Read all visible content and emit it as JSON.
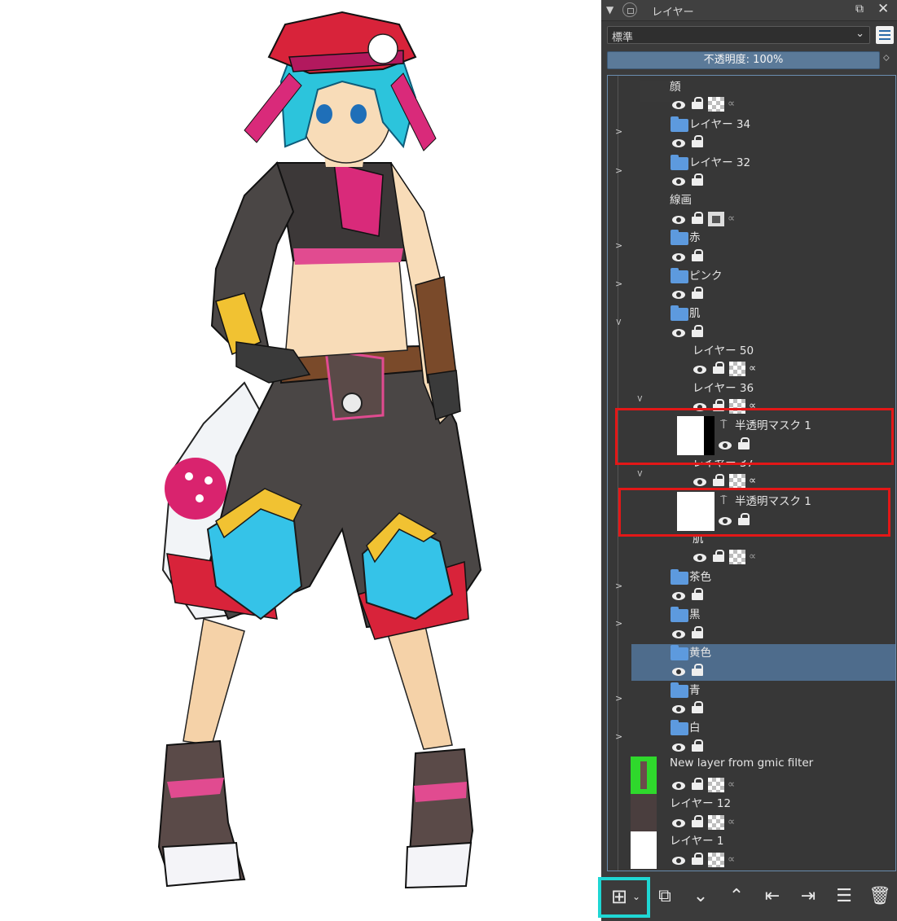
{
  "panel": {
    "title": "レイヤー",
    "blend_mode": "標準",
    "opacity_label": "不透明度:  100%"
  },
  "layers": [
    {
      "name": "顔"
    },
    {
      "name": "レイヤー 34"
    },
    {
      "name": "レイヤー 32"
    },
    {
      "name": "線画"
    },
    {
      "name": "赤"
    },
    {
      "name": "ピンク"
    },
    {
      "name": "肌"
    },
    {
      "name": "レイヤー 50"
    },
    {
      "name": "レイヤー 36"
    },
    {
      "name": "半透明マスク 1"
    },
    {
      "name": "レイヤー 37"
    },
    {
      "name": "半透明マスク 1"
    },
    {
      "name": "肌"
    },
    {
      "name": "茶色"
    },
    {
      "name": "黒"
    },
    {
      "name": "黄色",
      "selected": true
    },
    {
      "name": "青"
    },
    {
      "name": "白"
    },
    {
      "name": "New layer from gmic filter"
    },
    {
      "name": "レイヤー 12"
    },
    {
      "name": "レイヤー 1"
    }
  ],
  "canvas": {
    "image": "anime-girl-character-illustration",
    "hair_color": "#2cc4dc",
    "beret_color": "#d8233a",
    "accent_color": "#d92a7a"
  },
  "toolbar": {
    "icons": [
      "add-layer-icon",
      "duplicate-layer-icon",
      "move-down-icon",
      "move-up-icon",
      "outdent-icon",
      "indent-icon",
      "properties-icon",
      "delete-icon"
    ]
  },
  "colors": {
    "panel_bg": "#3b3b3b",
    "selection": "#4e6c8c",
    "folder": "#5d9ade",
    "highlight_red": "#e31717",
    "highlight_cyan": "#1fd7d4"
  }
}
